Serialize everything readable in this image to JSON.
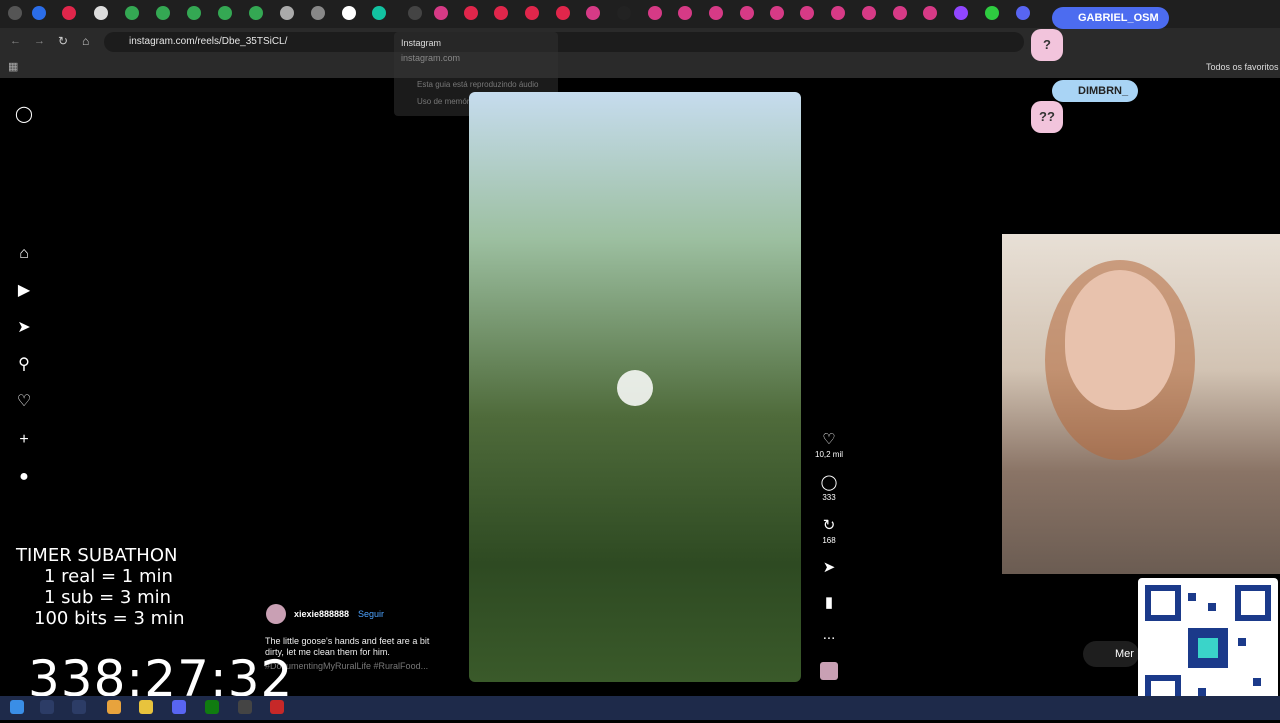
{
  "browser": {
    "url": "instagram.com/reels/Dbe_35TSiCL/",
    "favorites_label": "Todos os favoritos",
    "tab_tooltip": {
      "title": "Instagram",
      "domain": "instagram.com",
      "audio": "Esta guia está reproduzindo áudio",
      "memory": "Uso de memória: 470 MB"
    }
  },
  "reel": {
    "username": "xiexie888888",
    "follow_label": "Seguir",
    "caption": "The little goose's hands and feet are a bit dirty, let me clean them for him.",
    "hashtags": "#DocumentingMyRuralLife #RuralFood...",
    "likes": "10,2 mil",
    "comments": "333",
    "reposts": "168",
    "more": "..."
  },
  "overlay": {
    "subathon_title": "TIMER SUBATHON",
    "rule1": "1 real = 1 min",
    "rule2": "1 sub = 3 min",
    "rule3": "100 bits = 3 min",
    "timer": "338:27:32",
    "badge1": "GABRIEL_OSM",
    "badge2": "DIMBRN_",
    "question": "?",
    "question2": "??",
    "merch": "Mer"
  },
  "icons": [
    "instagram-icon",
    "home-icon",
    "reels-icon",
    "explore-icon",
    "search-icon",
    "heart-icon",
    "create-icon",
    "profile-icon"
  ]
}
